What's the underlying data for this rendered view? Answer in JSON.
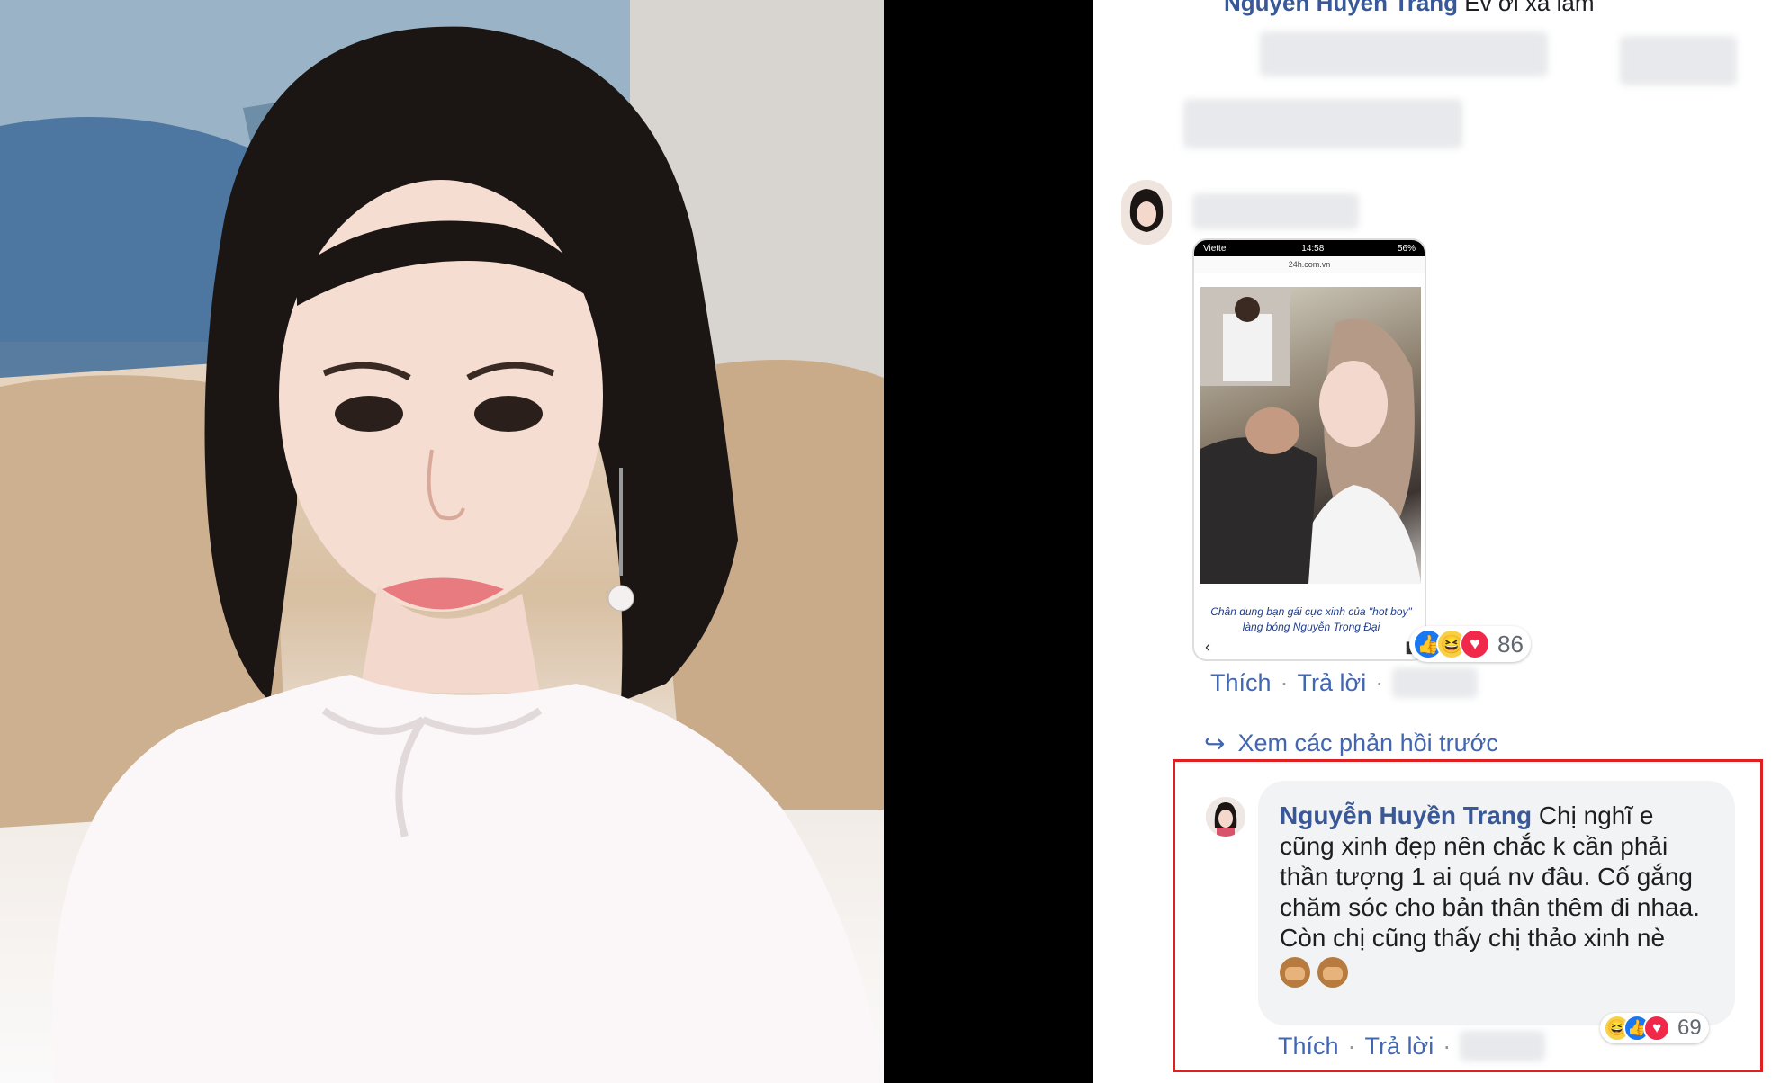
{
  "colors": {
    "name_blue": "#385898",
    "action_blue": "#4267b2",
    "highlight_red": "#e02020",
    "bubble_bg": "#f2f3f5"
  },
  "top_partial": {
    "name": "Nguyễn Huyền Trang",
    "text": "Ev ơi xa lắm"
  },
  "comment_one": {
    "phone_status_carrier": "Viettel",
    "phone_status_time": "14:58",
    "phone_status_battery": "56%",
    "phone_url": "24h.com.vn",
    "caption": "Chân dung bạn gái cực xinh của \"hot boy\" làng bóng Nguyễn Trọng Đại",
    "reaction_count": "86",
    "actions": {
      "like": "Thích",
      "reply": "Trả lời"
    }
  },
  "view_previous": "Xem các phản hồi trước",
  "highlighted_reply": {
    "author": "Nguyễn Huyền Trang",
    "text_line1": "Chị nghĩ e cũng xinh đẹp nên chắc k cần phải thần tượng 1 ai quá nv đâu. Cố gắng chăm sóc cho bản thân thêm đi nhaa.",
    "text_line2": "Còn chị cũng thấy chị thảo xinh nè",
    "emoji": [
      "see-no-evil-monkey",
      "see-no-evil-monkey"
    ],
    "reaction_count": "69",
    "actions": {
      "like": "Thích",
      "reply": "Trả lời"
    }
  }
}
